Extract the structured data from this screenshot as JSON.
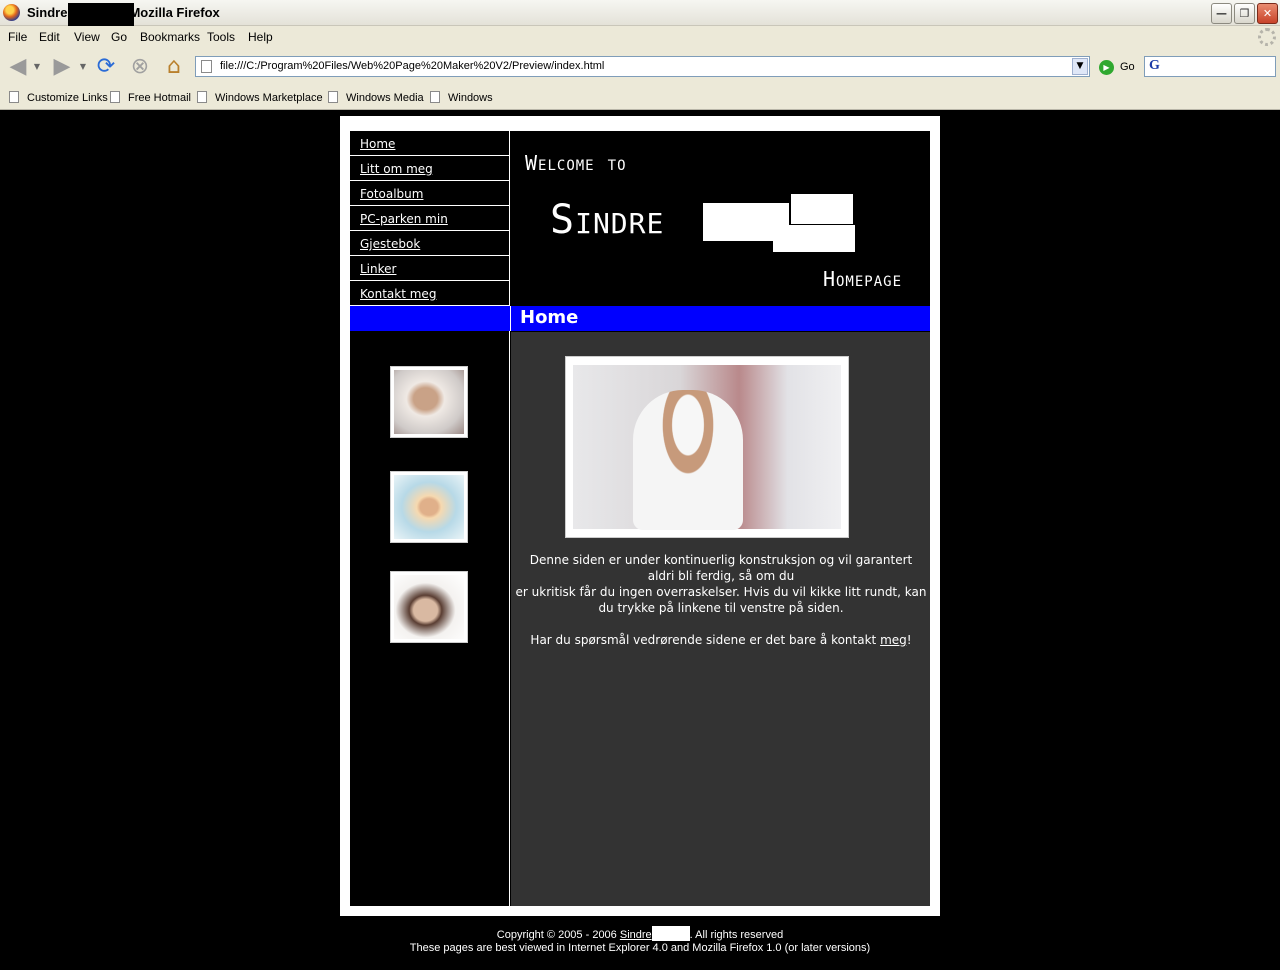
{
  "window": {
    "title_prefix": "Sindre",
    "title_suffix": "Mozilla Firefox",
    "min_label": "—",
    "max_label": "❐",
    "close_label": "✕"
  },
  "menu": [
    "File",
    "Edit",
    "View",
    "Go",
    "Bookmarks",
    "Tools",
    "Help"
  ],
  "toolbar": {
    "url": "file:///C:/Program%20Files/Web%20Page%20Maker%20V2/Preview/index.html",
    "go_label": "Go",
    "search_engine_letter": "G"
  },
  "bookmarks": [
    "Customize Links",
    "Free Hotmail",
    "Windows Marketplace",
    "Windows Media",
    "Windows"
  ],
  "site": {
    "nav": [
      "Home",
      "Litt om meg",
      "Fotoalbum",
      "PC-parken min",
      "Gjestebok",
      "Linker",
      "Kontakt meg"
    ],
    "header_welcome": "Welcome to",
    "header_name": "Sindre",
    "header_homepage": "Homepage",
    "section_heading": "Home",
    "text_line1": "Denne siden er under kontinuerlig konstruksjon og vil garantert aldri bli ferdig, så om du",
    "text_line2": "er ukritisk får du ingen overraskelser. Hvis du vil kikke litt rundt, kan du trykke på linkene til venstre på siden.",
    "text_line3_pre": "Har du spørsmål vedrørende sidene er det bare å kontakt ",
    "text_link": "meg",
    "text_line3_post": "!",
    "footer_line1_pre": "Copyright © 2005 - 2006 ",
    "footer_name": "Sindre",
    "footer_line1_post": ". All rights reserved",
    "footer_line2": "These pages are best viewed in Internet Explorer 4.0 and Mozilla Firefox 1.0 (or later versions)"
  },
  "colors": {
    "page_bg": "#000000",
    "heading_bar": "#0000ff",
    "content_bg": "#333333"
  }
}
